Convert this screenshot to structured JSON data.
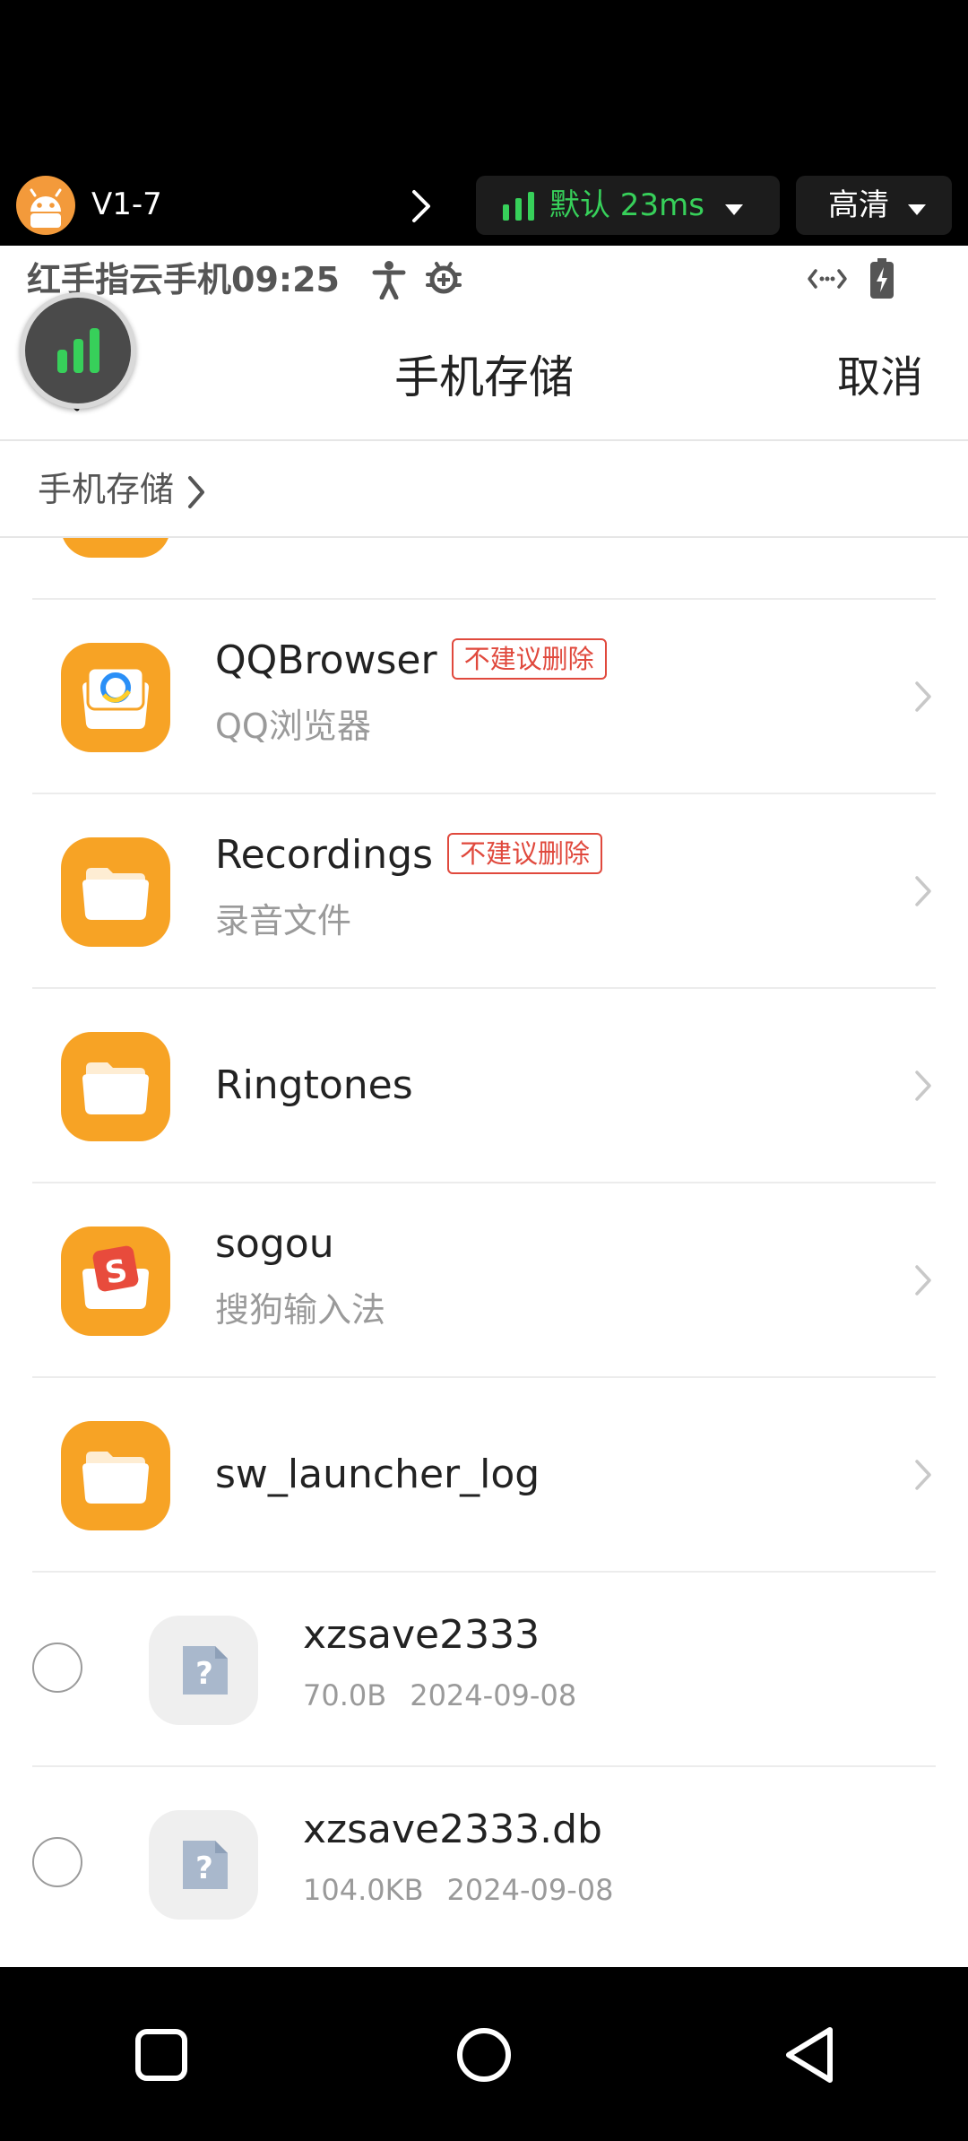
{
  "cloud_bar": {
    "device_name": "V1-7",
    "network": "默认 23ms",
    "quality": "高清"
  },
  "status_bar": {
    "text": "红手指云手机09:25"
  },
  "header": {
    "title": "手机存储",
    "cancel_label": "取消"
  },
  "breadcrumb": {
    "label": "手机存储"
  },
  "folders": [
    {
      "name": "QQBrowser",
      "subtitle": "QQ浏览器",
      "tag": "不建议删除",
      "icon": "qqbrowser-folder-icon"
    },
    {
      "name": "Recordings",
      "subtitle": "录音文件",
      "tag": "不建议删除",
      "icon": "folder-icon"
    },
    {
      "name": "Ringtones",
      "subtitle": "",
      "tag": "",
      "icon": "folder-icon"
    },
    {
      "name": "sogou",
      "subtitle": "搜狗输入法",
      "tag": "",
      "icon": "sogou-folder-icon"
    },
    {
      "name": "sw_launcher_log",
      "subtitle": "",
      "tag": "",
      "icon": "folder-icon"
    }
  ],
  "files": [
    {
      "name": "xzsave2333",
      "size": "70.0B",
      "date": "2024-09-08",
      "icon": "unknown-file-icon"
    },
    {
      "name": "xzsave2333.db",
      "size": "104.0KB",
      "date": "2024-09-08",
      "icon": "unknown-file-icon"
    }
  ],
  "colors": {
    "folder": "#f7a325",
    "tag": "#e0493d",
    "network_text": "#37d05a"
  }
}
